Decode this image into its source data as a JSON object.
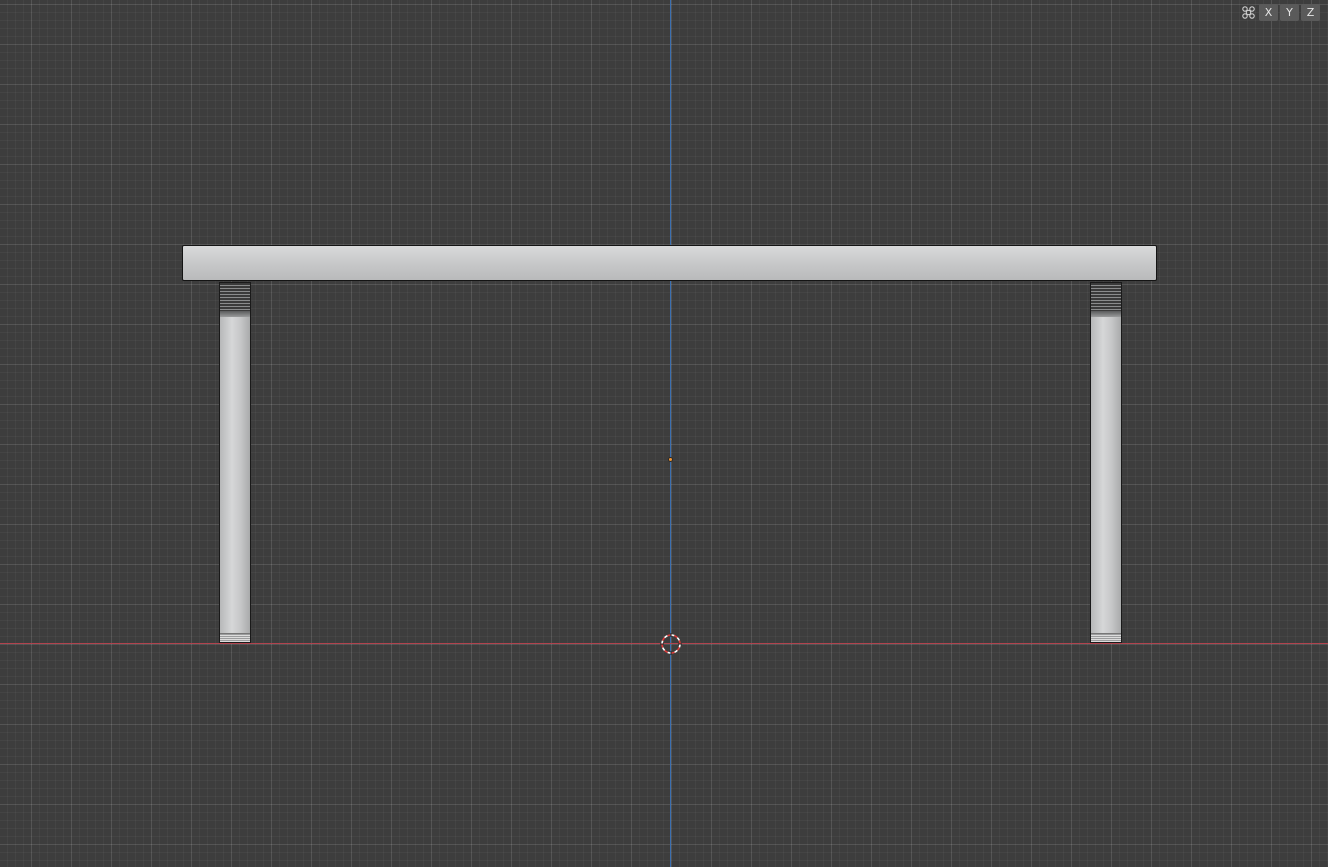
{
  "viewport": {
    "axis_colors": {
      "x": "#b2434e",
      "z": "#3b6fb0"
    },
    "background": "#3d3d3d",
    "objects": [
      {
        "id": "tabletop",
        "color": "#c6c7c8"
      },
      {
        "id": "leg-left",
        "color": "#c5c6c7"
      },
      {
        "id": "leg-right",
        "color": "#c5c6c7"
      }
    ],
    "origin_color": "#f29533",
    "cursor_colors": [
      "#e03b3b",
      "#ffffff"
    ]
  },
  "gizmo": {
    "icon": "object-gizmo-icon",
    "axes": [
      "X",
      "Y",
      "Z"
    ]
  }
}
